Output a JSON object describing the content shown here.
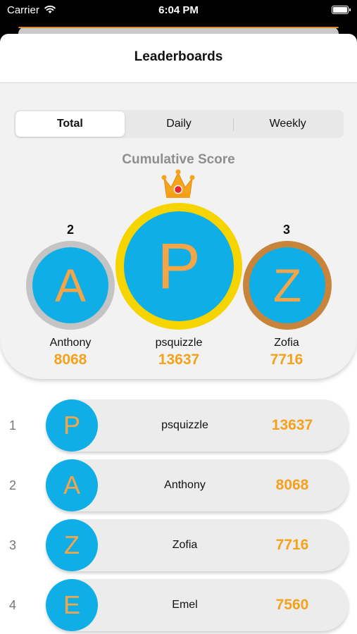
{
  "status_bar": {
    "carrier": "Carrier",
    "time": "6:04 PM"
  },
  "nav": {
    "title": "Leaderboards"
  },
  "segments": [
    {
      "label": "Total",
      "selected": true
    },
    {
      "label": "Daily",
      "selected": false
    },
    {
      "label": "Weekly",
      "selected": false
    }
  ],
  "podium": {
    "title": "Cumulative Score",
    "first": {
      "initial": "P",
      "name": "psquizzle",
      "score": "13637",
      "ring_color": "#f6d400"
    },
    "second": {
      "rank": "2",
      "initial": "A",
      "name": "Anthony",
      "score": "8068",
      "ring_color": "#c4c4c4"
    },
    "third": {
      "rank": "3",
      "initial": "Z",
      "name": "Zofia",
      "score": "7716",
      "ring_color": "#c8843a"
    }
  },
  "list": [
    {
      "rank": "1",
      "initial": "P",
      "name": "psquizzle",
      "score": "13637"
    },
    {
      "rank": "2",
      "initial": "A",
      "name": "Anthony",
      "score": "8068"
    },
    {
      "rank": "3",
      "initial": "Z",
      "name": "Zofia",
      "score": "7716"
    },
    {
      "rank": "4",
      "initial": "E",
      "name": "Emel",
      "score": "7560"
    }
  ],
  "colors": {
    "avatar": "#10aee6",
    "initial": "#f4a547",
    "score": "#f3a21d"
  }
}
